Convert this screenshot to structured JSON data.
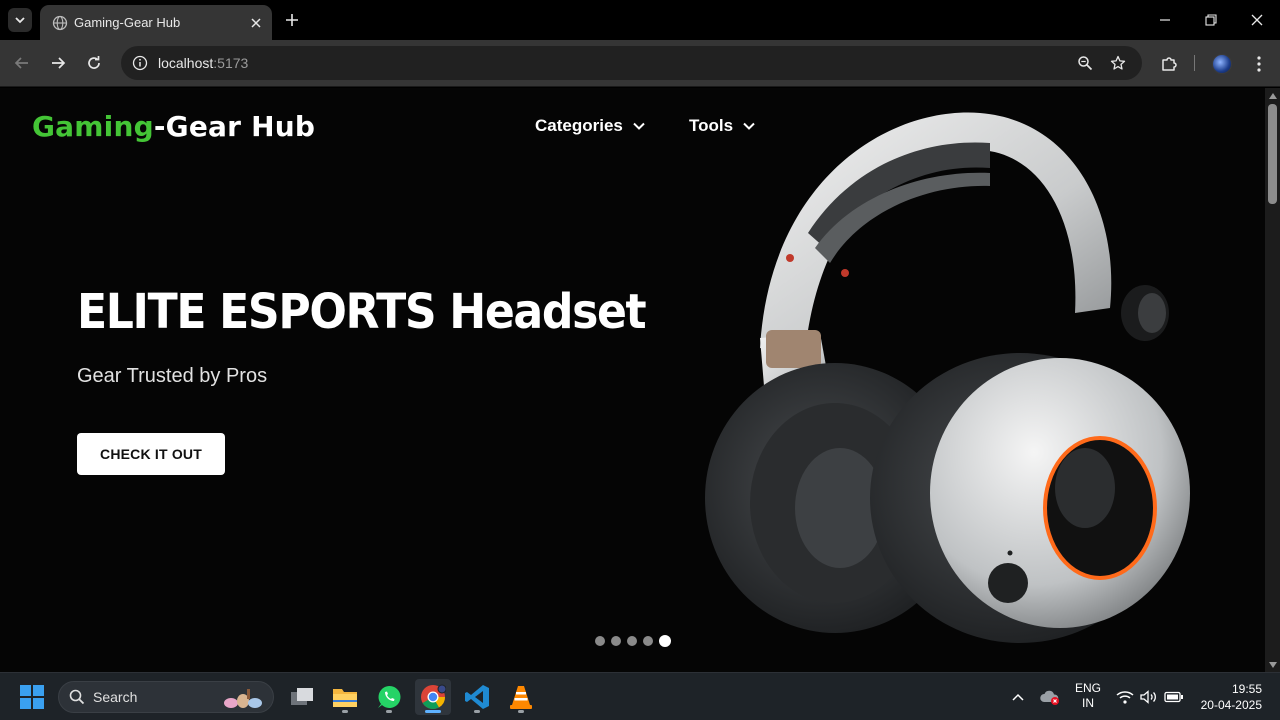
{
  "browser": {
    "tab": {
      "title": "Gaming-Gear Hub"
    },
    "address": {
      "host": "localhost",
      "port": ":5173"
    }
  },
  "site": {
    "logo": {
      "part1": "Gaming",
      "part2": "-Gear Hub"
    },
    "nav": [
      {
        "label": "Categories"
      },
      {
        "label": "Tools"
      }
    ],
    "hero": {
      "title": "ELITE ESPORTS Headset",
      "subtitle": "Gear Trusted by Pros",
      "cta": "CHECK IT OUT",
      "slide_count": 5,
      "active_slide": 5
    }
  },
  "taskbar": {
    "search_label": "Search",
    "language": {
      "line1": "ENG",
      "line2": "IN"
    },
    "time": "19:55",
    "date": "20-04-2025"
  },
  "colors": {
    "brand_green": "#44c536",
    "page_bg": "#050505",
    "accent_orange": "#ff6a1a"
  }
}
